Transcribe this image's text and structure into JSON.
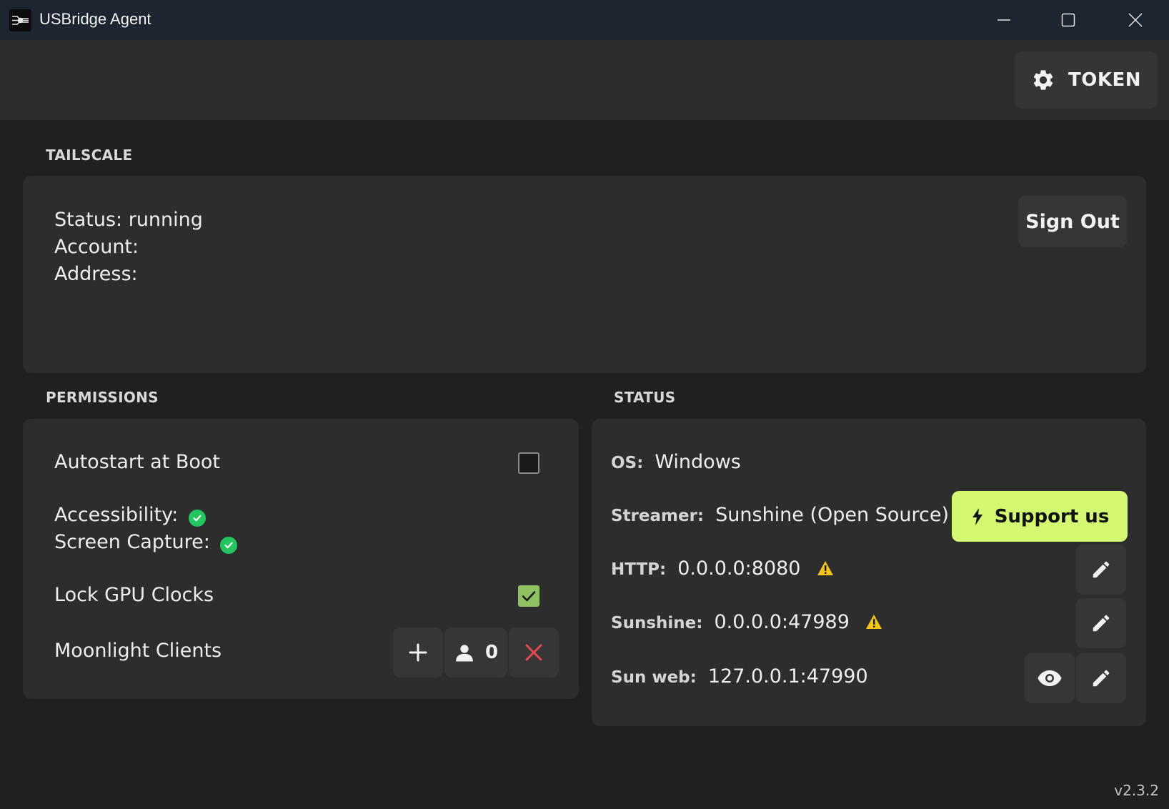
{
  "window": {
    "title": "USBridge Agent",
    "controls": {
      "minimize": "minimize-icon",
      "maximize": "maximize-icon",
      "close": "close-icon"
    }
  },
  "toolbar": {
    "token_label": "TOKEN",
    "token_icon": "gear-icon"
  },
  "tailscale": {
    "section_title": "TAILSCALE",
    "status": "Status: running",
    "account": "Account:",
    "address": "Address:",
    "sign_out_label": "Sign Out"
  },
  "permissions": {
    "section_title": "PERMISSIONS",
    "autostart_label": "Autostart at Boot",
    "autostart_checked": false,
    "accessibility_label": "Accessibility:",
    "accessibility_ok": true,
    "screen_capture_label": "Screen Capture:",
    "screen_capture_ok": true,
    "lock_gpu_label": "Lock GPU Clocks",
    "lock_gpu_checked": true,
    "moonlight_label": "Moonlight Clients",
    "moonlight_count": "0"
  },
  "status": {
    "section_title": "STATUS",
    "os_key": "OS:",
    "os_value": "Windows",
    "streamer_key": "Streamer:",
    "streamer_value": "Sunshine (Open Source)",
    "support_label": "Support us",
    "http_key": "HTTP:",
    "http_value": "0.0.0.0:8080",
    "sunshine_key": "Sunshine:",
    "sunshine_value": "0.0.0.0:47989",
    "sunweb_key": "Sun web:",
    "sunweb_value": "127.0.0.1:47990"
  },
  "version": "v2.3.2",
  "colors": {
    "background": "#202020",
    "card": "#2d2d2d",
    "titlebar": "#1d2530",
    "accent_support": "#d4f872",
    "check_green": "#22c55e",
    "warning_yellow": "#f5c518",
    "remove_red": "#e5484d",
    "checkbox_checked": "#8fc163"
  }
}
